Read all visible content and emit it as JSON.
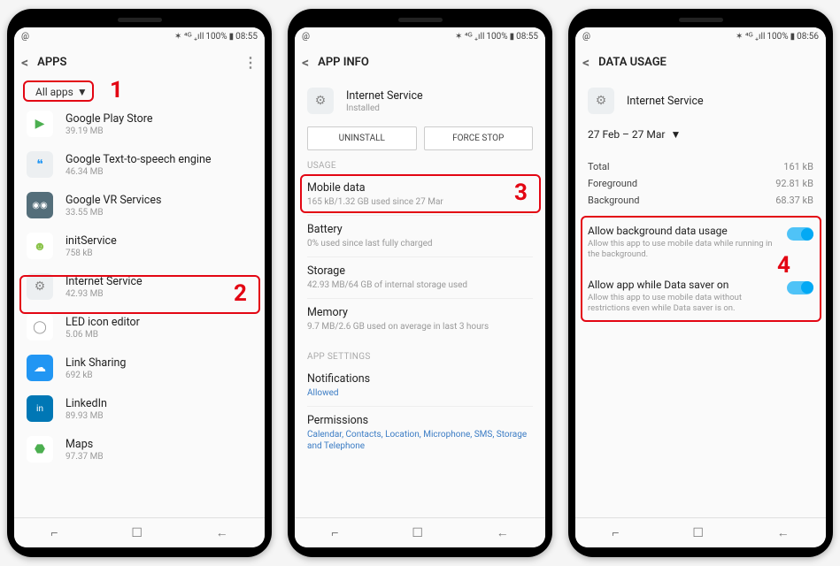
{
  "status": {
    "left_icon": "@",
    "signal": "✶ ⁴ᴳ ₊ıll",
    "battery": "100%",
    "time1": "08:55",
    "time3": "08:56"
  },
  "nav": {
    "recent": "⌐",
    "home": "☐",
    "back": "←"
  },
  "annotations": {
    "n1": "1",
    "n2": "2",
    "n3": "3",
    "n4": "4"
  },
  "screen1": {
    "title": "APPS",
    "filter": "All apps",
    "apps": [
      {
        "name": "Google Play Store",
        "size": "39.19 MB",
        "iconColor": "#fff",
        "iconGlyph": "▶",
        "iconText": "#4caf50"
      },
      {
        "name": "Google Text-to-speech engine",
        "size": "46.34 MB",
        "iconColor": "#eceff1",
        "iconGlyph": "❝",
        "iconText": "#2196f3"
      },
      {
        "name": "Google VR Services",
        "size": "33.55 MB",
        "iconColor": "#546e7a",
        "iconGlyph": "◉◉",
        "iconText": "#fff"
      },
      {
        "name": "initService",
        "size": "758 kB",
        "iconColor": "#fff",
        "iconGlyph": "☻",
        "iconText": "#8bc34a"
      },
      {
        "name": "Internet Service",
        "size": "42.93 MB",
        "iconColor": "#eceff1",
        "iconGlyph": "⚙",
        "iconText": "#888"
      },
      {
        "name": "LED icon editor",
        "size": "5.06 MB",
        "iconColor": "#fff",
        "iconGlyph": "◯",
        "iconText": "#999"
      },
      {
        "name": "Link Sharing",
        "size": "692 kB",
        "iconColor": "#2196f3",
        "iconGlyph": "☁",
        "iconText": "#fff"
      },
      {
        "name": "LinkedIn",
        "size": "89.93 MB",
        "iconColor": "#0077b5",
        "iconGlyph": "in",
        "iconText": "#fff"
      },
      {
        "name": "Maps",
        "size": "97.37 MB",
        "iconColor": "#fff",
        "iconGlyph": "⬣",
        "iconText": "#4caf50"
      }
    ]
  },
  "screen2": {
    "title": "APP INFO",
    "app_name": "Internet Service",
    "app_status": "Installed",
    "btn_uninstall": "UNINSTALL",
    "btn_forcestop": "FORCE STOP",
    "section_usage": "USAGE",
    "mobile_data": {
      "title": "Mobile data",
      "sub": "165 kB/1.32 GB used since 27 Mar"
    },
    "battery": {
      "title": "Battery",
      "sub": "0% used since last fully charged"
    },
    "storage": {
      "title": "Storage",
      "sub": "42.93 MB/64 GB of internal storage used"
    },
    "memory": {
      "title": "Memory",
      "sub": "9.7 MB/2.6 GB used on average in last 3 hours"
    },
    "section_appsettings": "APP SETTINGS",
    "notifications": {
      "title": "Notifications",
      "sub": "Allowed"
    },
    "permissions": {
      "title": "Permissions",
      "sub": "Calendar, Contacts, Location, Microphone, SMS, Storage and Telephone"
    }
  },
  "screen3": {
    "title": "DATA USAGE",
    "app_name": "Internet Service",
    "date_range": "27 Feb – 27 Mar",
    "rows": [
      {
        "label": "Total",
        "val": "161 kB"
      },
      {
        "label": "Foreground",
        "val": "92.81 kB"
      },
      {
        "label": "Background",
        "val": "68.37 kB"
      }
    ],
    "toggle1": {
      "title": "Allow background data usage",
      "sub": "Allow this app to use mobile data while running in the background."
    },
    "toggle2": {
      "title": "Allow app while Data saver on",
      "sub": "Allow this app to use mobile data without restrictions even while Data saver is on."
    }
  }
}
